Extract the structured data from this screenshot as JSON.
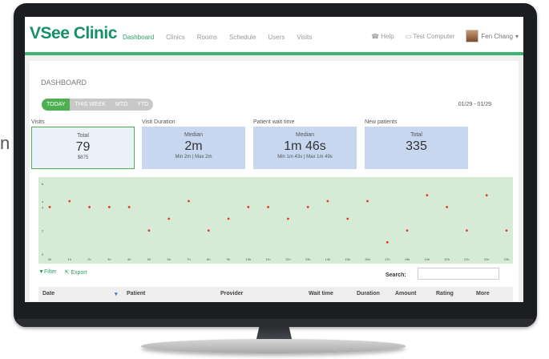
{
  "cut_letter": "n",
  "brand": "VSee Clinic",
  "nav": {
    "links": [
      "Dashboard",
      "Clinics",
      "Rooms",
      "Schedule",
      "Users",
      "Visits"
    ],
    "help": "Help",
    "test_computer": "Test Computer",
    "user": "Fen Chang"
  },
  "page_title": "DASHBOARD",
  "range_tabs": [
    "TODAY",
    "THIS WEEK",
    "MTD",
    "YTD"
  ],
  "date_range": "01/29 - 01/29",
  "cards": [
    {
      "label": "Visits",
      "l1": "Total",
      "big": "79",
      "sub": "$875"
    },
    {
      "label": "Visit Duration",
      "l1": "Median",
      "big": "2m",
      "sub": "Min 2m | Max 2m"
    },
    {
      "label": "Patient wait time",
      "l1": "Median",
      "big": "1m 46s",
      "sub": "Min 1m 43s | Max 1m 49s"
    },
    {
      "label": "New patients",
      "l1": "Total",
      "big": "335",
      "sub": ""
    }
  ],
  "chart_data": {
    "type": "scatter",
    "x": [
      "0h",
      "1h",
      "2h",
      "3h",
      "4h",
      "5h",
      "6h",
      "7h",
      "8h",
      "9h",
      "10h",
      "11h",
      "12h",
      "13h",
      "14h",
      "15h",
      "16h",
      "17h",
      "18h",
      "19h",
      "20h",
      "21h",
      "22h",
      "23h"
    ],
    "y": [
      4,
      4.5,
      4,
      4,
      4,
      2,
      3,
      4.5,
      2,
      3,
      4,
      4,
      3,
      4,
      4.5,
      3,
      4.5,
      1,
      2,
      5,
      4,
      2,
      5,
      2
    ],
    "yticks": [
      "0",
      "2",
      "4",
      "4",
      "6"
    ],
    "ylim": [
      0,
      6
    ],
    "point_color": "#e53935",
    "background": "#d6ebd6"
  },
  "table_tools": {
    "filter": "Filter",
    "export": "Export",
    "search_label": "Search:",
    "search_value": ""
  },
  "table_headers": [
    "Date",
    "Patient",
    "Provider",
    "Wait time",
    "Duration",
    "Amount",
    "Rating",
    "More"
  ]
}
